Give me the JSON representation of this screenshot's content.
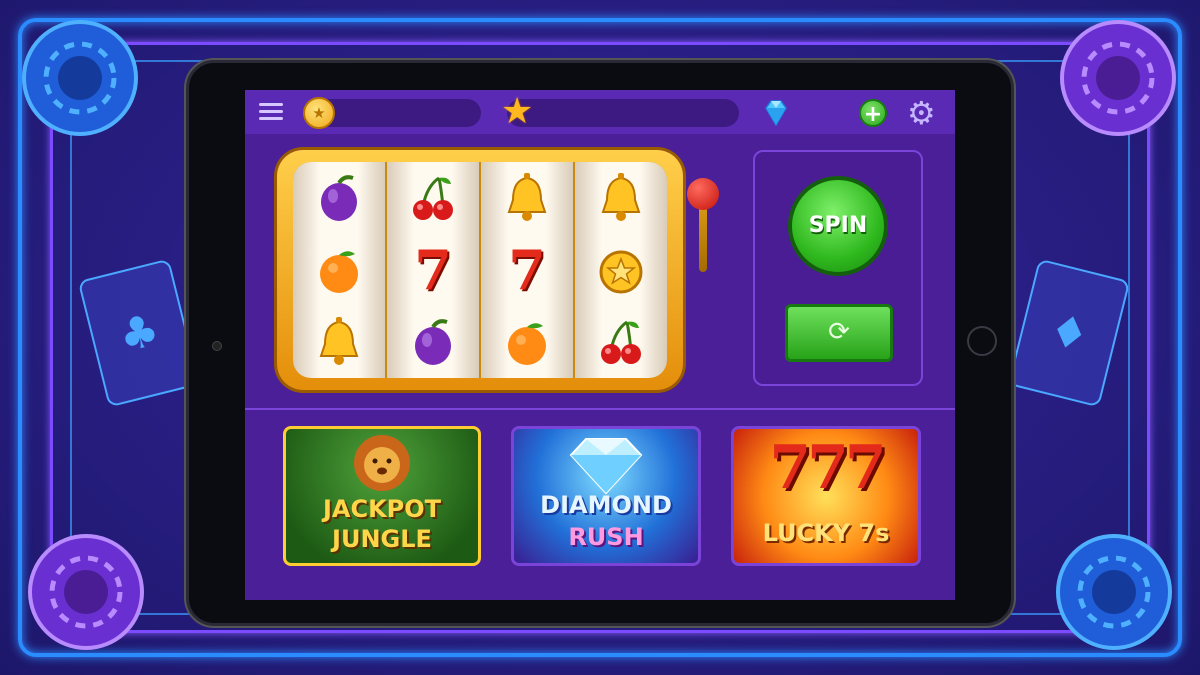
{
  "topbar": {
    "coin_symbol": "★",
    "star_symbol": "★",
    "plus_label": "+",
    "gear_symbol": "⚙"
  },
  "reels": [
    [
      "plum",
      "orange",
      "bell"
    ],
    [
      "cherry",
      "7",
      "plum"
    ],
    [
      "bell",
      "7",
      "orange"
    ],
    [
      "bell",
      "star-coin",
      "cherry"
    ]
  ],
  "controls": {
    "spin_label": "SPIN",
    "autospin_symbol": "⟳"
  },
  "games": [
    {
      "line1": "JACKPOT",
      "line2": "JUNGLE"
    },
    {
      "line1": "DIAMOND",
      "line2": "RUSH"
    },
    {
      "line1": "777",
      "line2": "LUCKY 7s"
    }
  ],
  "colors": {
    "accent": "#5b2ab5",
    "spin_green": "#2fb81e",
    "gold": "#ffcf4a",
    "seven_red": "#e42a1a"
  }
}
